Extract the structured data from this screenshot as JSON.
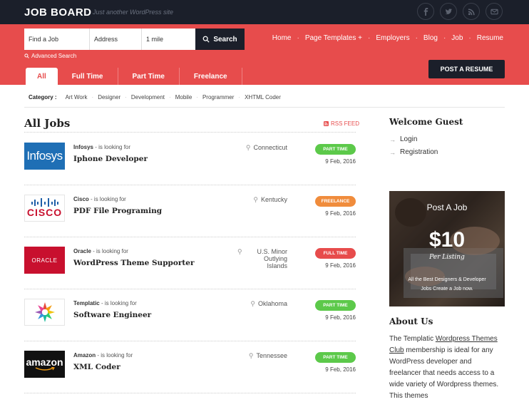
{
  "site": {
    "name": "JOB BOARD",
    "tagline": "Just another WordPress site"
  },
  "social": [
    "facebook-icon",
    "twitter-icon",
    "rss-icon",
    "email-icon"
  ],
  "search": {
    "job_placeholder": "Find a Job",
    "address_placeholder": "Address",
    "radius_value": "1 mile",
    "button_label": "Search",
    "advanced_label": "Advanced Search"
  },
  "nav": {
    "items": [
      "Home",
      "Page Templates +",
      "Employers",
      "Blog",
      "Job",
      "Resume"
    ]
  },
  "tabs": [
    "All",
    "Full Time",
    "Part Time",
    "Freelance"
  ],
  "post_resume_label": "POST A RESUME",
  "category": {
    "label": "Category :",
    "items": [
      "Art Work",
      "Designer",
      "Development",
      "Mobile",
      "Programmer",
      "XHTML Coder"
    ]
  },
  "jobs": {
    "title": "All Jobs",
    "rss_label": "RSS FEED",
    "looking_for": "- is looking for",
    "list": [
      {
        "company": "Infosys",
        "title": "Iphone Developer",
        "location": "Connecticut",
        "type": "PART TIME",
        "type_color": "#5cc94a",
        "date": "9 Feb, 2016",
        "logo_text": "Infosys"
      },
      {
        "company": "Cisco",
        "title": "PDF File Programing",
        "location": "Kentucky",
        "type": "FREELANCE",
        "type_color": "#f08c3c",
        "date": "9 Feb, 2016",
        "logo_text": "CISCO"
      },
      {
        "company": "Oracle",
        "title": "WordPress Theme Supporter",
        "location": "U.S. Minor Outlying Islands",
        "type": "FULL TIME",
        "type_color": "#e74c4c",
        "date": "9 Feb, 2016",
        "logo_text": "ORACLE"
      },
      {
        "company": "Templatic",
        "title": "Software Engineer",
        "location": "Oklahoma",
        "type": "PART TIME",
        "type_color": "#5cc94a",
        "date": "9 Feb, 2016",
        "logo_text": ""
      },
      {
        "company": "Amazon",
        "title": "XML Coder",
        "location": "Tennessee",
        "type": "PART TIME",
        "type_color": "#5cc94a",
        "date": "9 Feb, 2016",
        "logo_text": "amazon"
      }
    ]
  },
  "sidebar": {
    "welcome": "Welcome Guest",
    "login": "Login",
    "registration": "Registration",
    "promo": {
      "title": "Post A Job",
      "price": "$10",
      "per": "Per Listing",
      "line1": "All the Best Designers & Developer",
      "line2": "Jobs Create a Job now."
    },
    "about_title": "About Us",
    "about_pre": "The Templatic ",
    "about_link": "Wordpress Themes Club",
    "about_post": " membership is ideal for any WordPress developer and freelancer that needs access to a wide variety of Wordpress themes. This themes"
  }
}
